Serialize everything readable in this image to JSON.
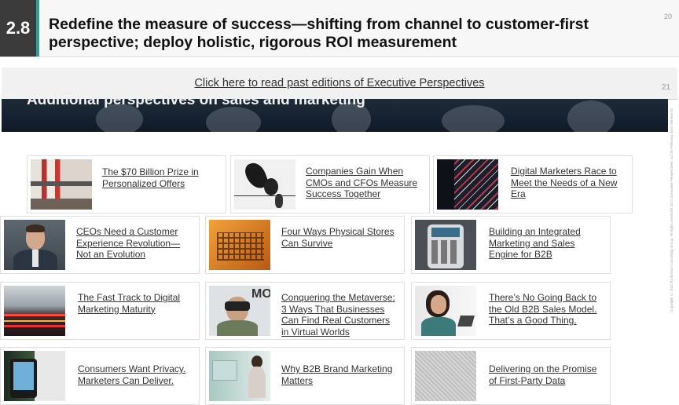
{
  "header": {
    "section_number": "2.8",
    "title": "Redefine the measure of success—shifting from channel to customer-first perspective; deploy holistic, rigorous ROI measurement",
    "page_number": "20"
  },
  "overlay": {
    "link_text": "Click here to read past editions of Executive Perspectives",
    "page_number": "21",
    "copyright": "Copyright © 2022 by Boston Consulting Group. All rights reserved. BCG Executive Perspectives, vol 25 February 2022 Version 01"
  },
  "banner": {
    "title": "Additional perspectives on sales and marketing"
  },
  "articles": [
    {
      "title": "The $70 Billion Prize in Personalized Offers",
      "thumb": "shopping-shelves-image"
    },
    {
      "title": "Companies Gain When CMOs and CFOs Measure Success Together",
      "thumb": "birds-on-wire-image"
    },
    {
      "title": "Digital Marketers Race to Meet the Needs of a New Era",
      "thumb": "zigzag-building-image"
    },
    {
      "title": "CEOs Need a Customer Experience Revolution—Not an Evolution",
      "thumb": "businessman-portrait-image"
    },
    {
      "title": "Four Ways Physical Stores Can Survive",
      "thumb": "shopping-cart-image"
    },
    {
      "title": "Building an Integrated Marketing and Sales Engine for B2B",
      "thumb": "payment-terminal-image"
    },
    {
      "title": "The Fast Track to Digital Marketing Maturity",
      "thumb": "light-trails-image"
    },
    {
      "title": "Conquering the Metaverse: 3 Ways That Businesses Can Find Real Customers in Virtual Worlds",
      "thumb": "vr-headset-image"
    },
    {
      "title": "There’s No Going Back to the Old B2B Sales Model. That’s a Good Thing.",
      "thumb": "woman-on-phone-image"
    },
    {
      "title": "Consumers Want Privacy. Marketers Can Deliver.",
      "thumb": "privacy-device-image"
    },
    {
      "title": "Why B2B Brand Marketing Matters",
      "thumb": "office-woman-image"
    },
    {
      "title": "Delivering on the Promise of First-Party Data",
      "thumb": "texture-pattern-image"
    }
  ],
  "colors": {
    "accent": "#2f9e8f",
    "badge": "#3b3b3b",
    "banner": "#1a2633"
  }
}
